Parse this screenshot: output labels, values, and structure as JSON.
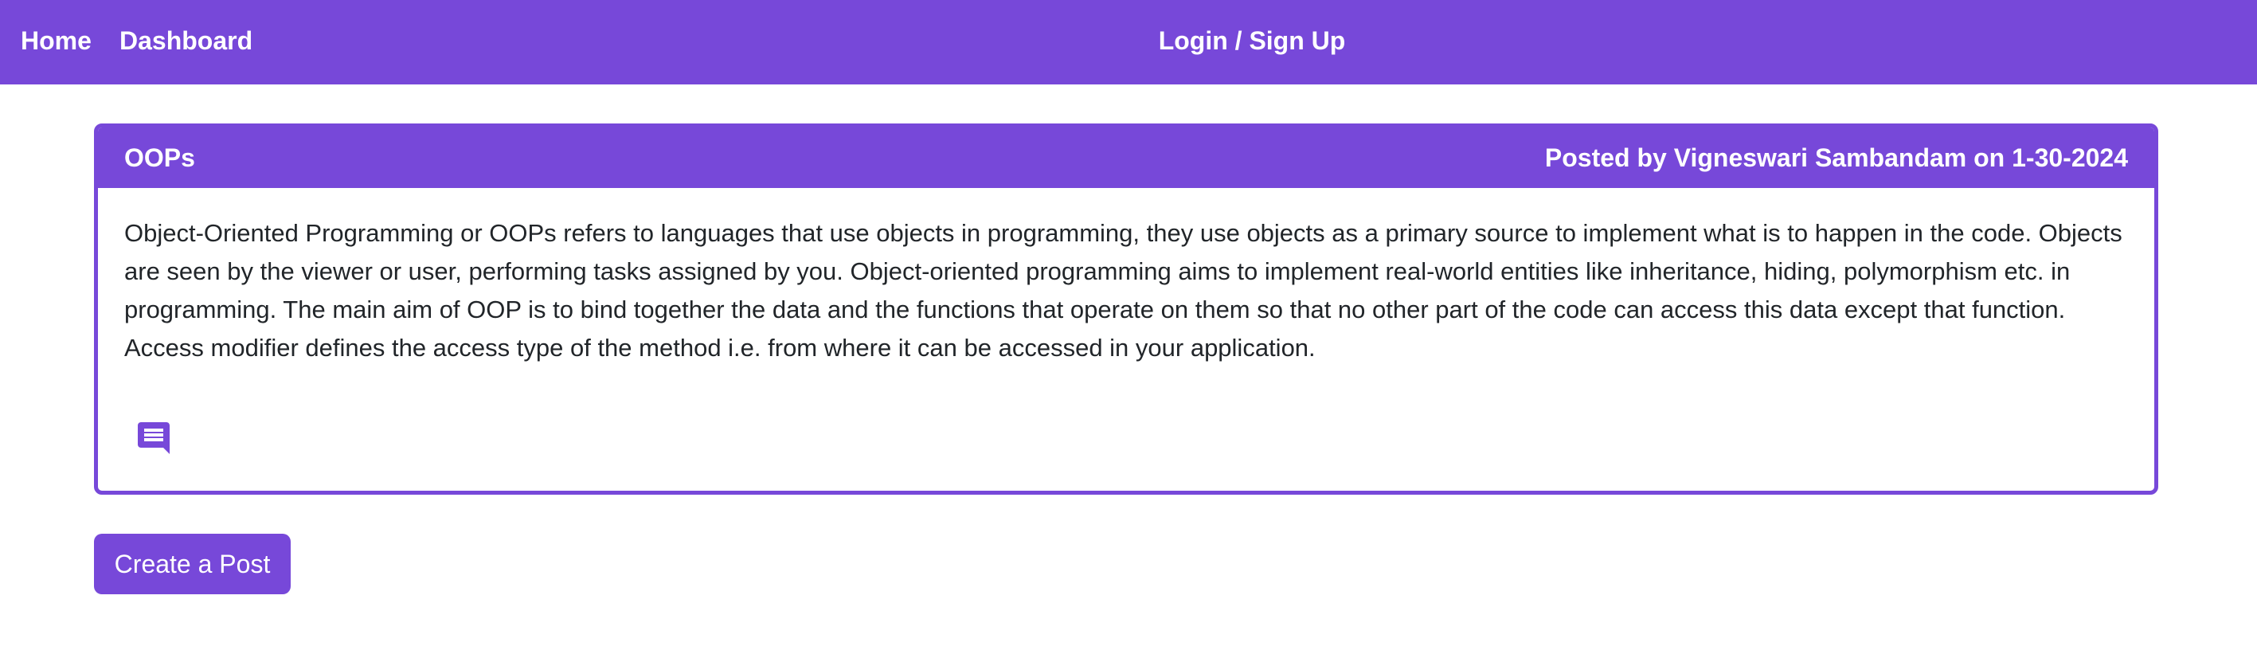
{
  "nav": {
    "home": "Home",
    "dashboard": "Dashboard",
    "login": "Login / Sign Up"
  },
  "post": {
    "title": "OOPs",
    "meta": "Posted by Vigneswari Sambandam on 1-30-2024",
    "body": "Object-Oriented Programming or OOPs refers to languages that use objects in programming, they use objects as a primary source to implement what is to happen in the code. Objects are seen by the viewer or user, performing tasks assigned by you. Object-oriented programming aims to implement real-world entities like inheritance, hiding, polymorphism etc. in programming. The main aim of OOP is to bind together the data and the functions that operate on them so that no other part of the code can access this data except that function. Access modifier defines the access type of the method i.e. from where it can be accessed in your application.",
    "comment_icon": "comment-icon"
  },
  "actions": {
    "create_post": "Create a Post"
  },
  "colors": {
    "accent": "#7748d9",
    "text": "#212529",
    "background": "#ffffff"
  }
}
